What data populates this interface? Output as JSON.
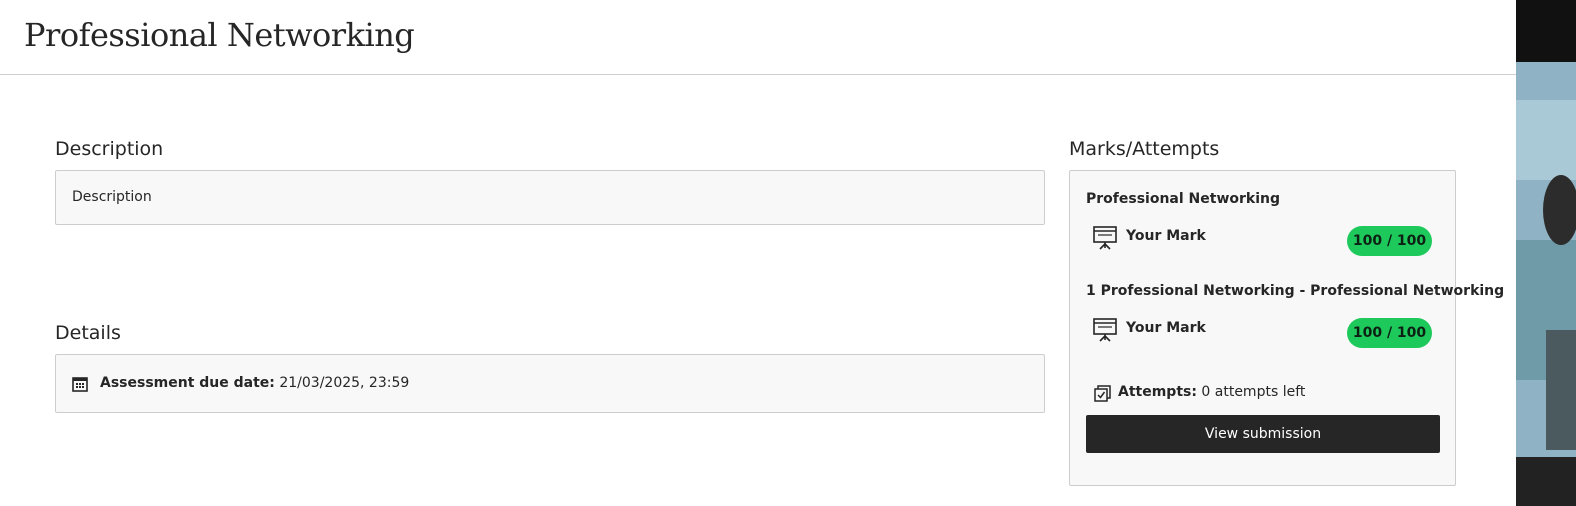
{
  "page": {
    "title": "Professional Networking"
  },
  "description": {
    "heading": "Description",
    "text": "Description"
  },
  "details": {
    "heading": "Details",
    "due_label": "Assessment due date:",
    "due_value": "21/03/2025, 23:59",
    "icon": "calendar-icon"
  },
  "marks": {
    "heading": "Marks/Attempts",
    "items": [
      {
        "title": "Professional Networking",
        "label": "Your Mark",
        "score": "100 / 100",
        "icon": "presentation-icon"
      },
      {
        "title": "1 Professional Networking - Professional Networking",
        "label": "Your Mark",
        "score": "100 / 100",
        "icon": "presentation-icon"
      }
    ],
    "attempts_label": "Attempts:",
    "attempts_value": "0 attempts left",
    "button_label": "View submission",
    "badge_color": "#1ec95b"
  }
}
